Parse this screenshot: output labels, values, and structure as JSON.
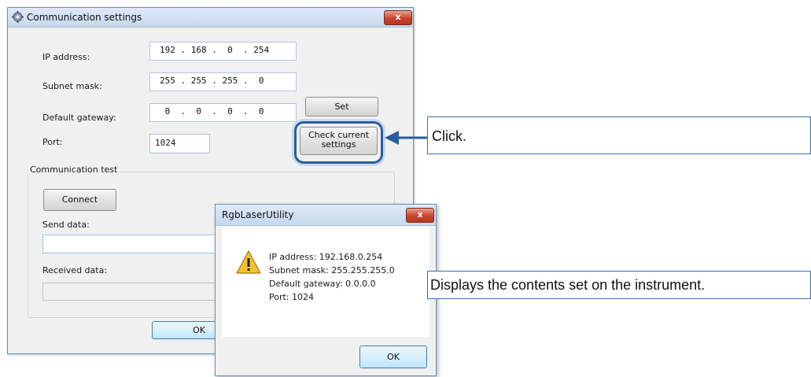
{
  "main_window": {
    "title": "Communication settings",
    "close_label": "x",
    "ip_label": "IP address:",
    "ip_value": "192 . 168 .  0  . 254",
    "subnet_label": "Subnet mask:",
    "subnet_value": "255 . 255 . 255 .  0",
    "gateway_label": "Default gateway:",
    "gateway_value": " 0  .  0  .  0  .  0",
    "port_label": "Port:",
    "port_value": "1024",
    "set_button": "Set",
    "check_button_line1": "Check current",
    "check_button_line2": "settings",
    "comm_test_label": "Communication test",
    "connect_button": "Connect",
    "send_label": "Send data:",
    "received_label": "Received data:",
    "ok_button": "OK"
  },
  "dialog": {
    "title": "RgbLaserUtility",
    "close_label": "x",
    "icon": "warning-icon",
    "lines": [
      "IP address: 192.168.0.254",
      "Subnet mask: 255.255.255.0",
      "Default gateway: 0.0.0.0",
      "Port: 1024"
    ],
    "ok_button": "OK"
  },
  "callouts": {
    "click": "Click.",
    "displays": "Displays the contents set on the instrument."
  },
  "colors": {
    "accent": "#2a5e9f",
    "close_red": "#c8442c",
    "warning_yellow": "#f2c12e"
  }
}
